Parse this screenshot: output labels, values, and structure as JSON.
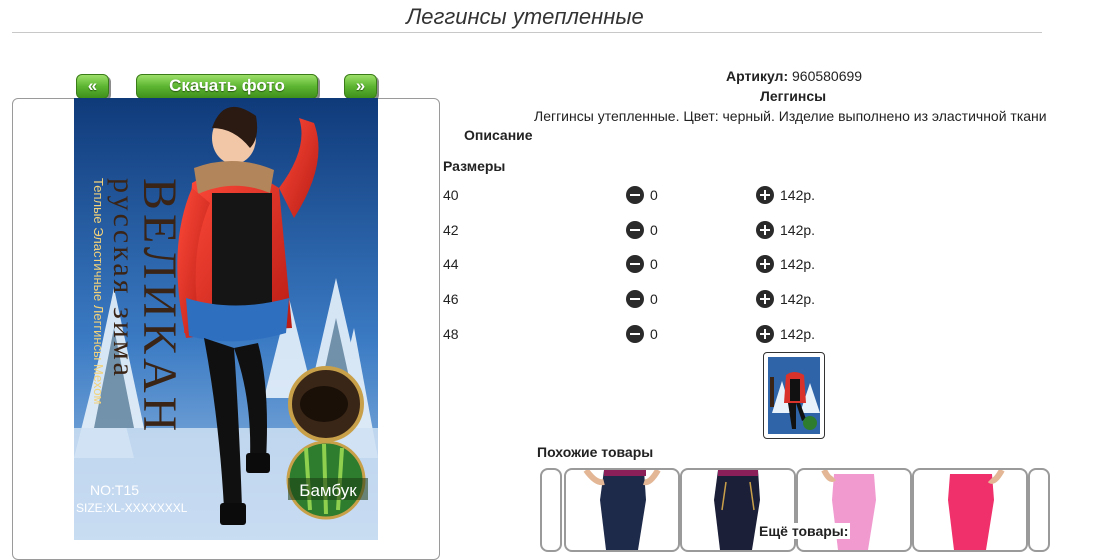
{
  "page": {
    "title": "Леггинсы утепленные"
  },
  "gallery": {
    "prev_label": "«",
    "download_label": "Скачать фото",
    "next_label": "»"
  },
  "product_image": {
    "brand_line1": "ВЕЛИКАН",
    "brand_line2": "русская зима",
    "side_text": "Теплые Эластичные Леггинсы Мехом",
    "model": "NO:T15",
    "size_range": "SIZE:XL-XXXXXXXL",
    "badge": "Бамбук"
  },
  "details": {
    "article_label": "Артикул:",
    "article_value": "960580699",
    "category": "Леггинсы",
    "description": "Леггинсы утепленные. Цвет: черный. Изделие выполнено из эластичной ткани",
    "description_label": "Описание",
    "sizes_label": "Размеры",
    "sizes": [
      {
        "size": "40",
        "qty": "0",
        "price": "142р."
      },
      {
        "size": "42",
        "qty": "0",
        "price": "142р."
      },
      {
        "size": "44",
        "qty": "0",
        "price": "142р."
      },
      {
        "size": "46",
        "qty": "0",
        "price": "142р."
      },
      {
        "size": "48",
        "qty": "0",
        "price": "142р."
      }
    ]
  },
  "similar": {
    "label": "Похожие товары",
    "more_label": "Ещё товары:",
    "colors": [
      "#1e2a4a",
      "#1c1f38",
      "#f09ad0",
      "#f0306a"
    ]
  },
  "colors": {
    "button_green": "#5cb531",
    "icon_dark": "#2a2a2a"
  }
}
